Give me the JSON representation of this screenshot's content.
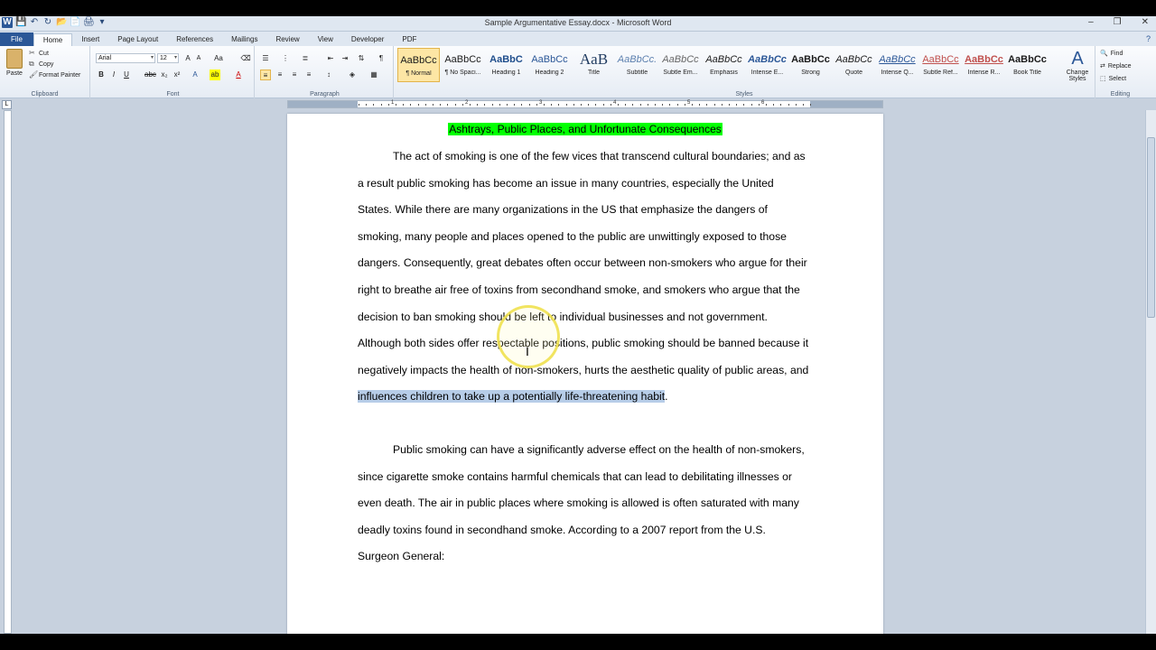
{
  "window": {
    "title": "Sample Argumentative Essay.docx - Microsoft Word",
    "minimize": "‒",
    "restore": "❐",
    "close": "✕"
  },
  "quick_access": [
    "W",
    "💾",
    "↶",
    "↻",
    "📂",
    "📄",
    "🖨",
    "▾"
  ],
  "tabs": [
    "File",
    "Home",
    "Insert",
    "Page Layout",
    "References",
    "Mailings",
    "Review",
    "View",
    "Developer",
    "PDF"
  ],
  "active_tab": "Home",
  "ribbon": {
    "clipboard": {
      "paste": "Paste",
      "cut": "Cut",
      "copy": "Copy",
      "format_painter": "Format Painter",
      "label": "Clipboard"
    },
    "font": {
      "name": "Arial",
      "size": "12",
      "label": "Font"
    },
    "paragraph": {
      "label": "Paragraph"
    },
    "styles": {
      "label": "Styles",
      "items": [
        {
          "sample": "AaBbCc",
          "name": "¶ Normal"
        },
        {
          "sample": "AaBbCc",
          "name": "¶ No Spaci..."
        },
        {
          "sample": "AaBbC",
          "name": "Heading 1"
        },
        {
          "sample": "AaBbCc",
          "name": "Heading 2"
        },
        {
          "sample": "AaB",
          "name": "Title"
        },
        {
          "sample": "AaBbCc.",
          "name": "Subtitle"
        },
        {
          "sample": "AaBbCc",
          "name": "Subtle Em..."
        },
        {
          "sample": "AaBbCc",
          "name": "Emphasis"
        },
        {
          "sample": "AaBbCc",
          "name": "Intense E..."
        },
        {
          "sample": "AaBbCc",
          "name": "Strong"
        },
        {
          "sample": "AaBbCc",
          "name": "Quote"
        },
        {
          "sample": "AaBbCc",
          "name": "Intense Q..."
        },
        {
          "sample": "AaBbCc",
          "name": "Subtle Ref..."
        },
        {
          "sample": "AaBbCc",
          "name": "Intense R..."
        },
        {
          "sample": "AaBbCc",
          "name": "Book Title"
        }
      ],
      "change_styles": "Change Styles"
    },
    "editing": {
      "find": "Find",
      "replace": "Replace",
      "select": "Select",
      "label": "Editing"
    }
  },
  "ruler": {
    "numbers": [
      "1",
      "2",
      "3",
      "4",
      "5",
      "6"
    ]
  },
  "document": {
    "title": "Ashtrays, Public Places, and Unfortunate Consequences",
    "para1_before": "The act of smoking is one of the few vices that transcend cultural boundaries; and as a result public smoking has become an issue in many countries, especially the United States. While there are many organizations in the US that emphasize the dangers of smoking, many people and places opened to the public are unwittingly exposed to those dangers. Consequently, great debates often occur between non-smokers who argue for their right to breathe air free of toxins from secondhand smoke, and smokers who argue that the decision to ban smoking should be left to individual businesses and not government. Although both sides offer respectable positions, public smoking should be banned because it negatively impacts the health of non-smokers, hurts the aesthetic quality of public areas, and ",
    "para1_highlight": "influences children to take up a potentially life-threatening habit",
    "para1_after": ".",
    "para2": "Public smoking can have a significantly adverse effect on the health of non-smokers, since cigarette smoke contains harmful chemicals that can lead to debilitating illnesses or even death.  The air in public places where smoking is allowed is often saturated with many deadly toxins found in secondhand smoke. According to a 2007 report from the U.S. Surgeon General:"
  }
}
